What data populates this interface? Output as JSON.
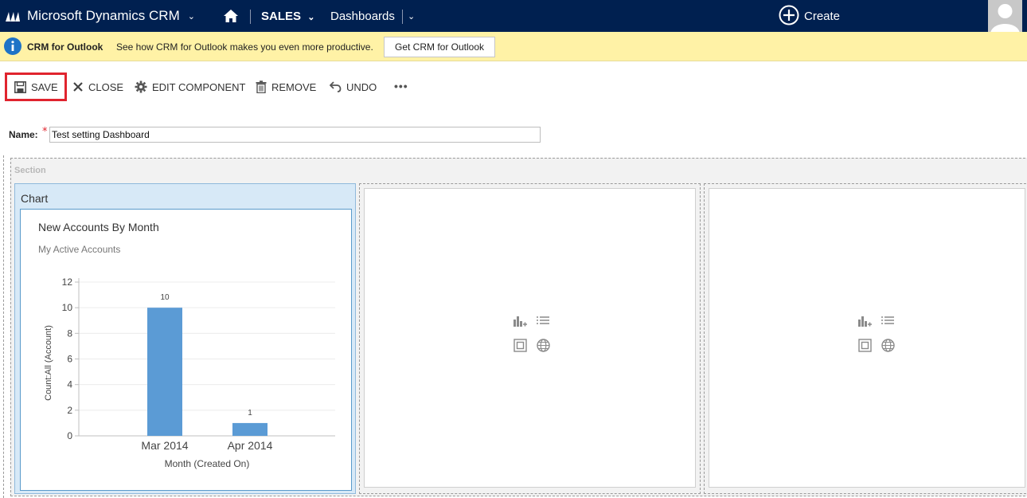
{
  "topnav": {
    "brand": "Microsoft Dynamics CRM",
    "area": "SALES",
    "section": "Dashboards",
    "create_label": "Create",
    "bg_color": "#002050"
  },
  "notification": {
    "title": "CRM for Outlook",
    "message": "See how CRM for Outlook makes you even more productive.",
    "button_label": "Get CRM for Outlook",
    "bg_color": "#fff2a6"
  },
  "commandbar": {
    "save": "SAVE",
    "close": "CLOSE",
    "edit_component": "EDIT COMPONENT",
    "remove": "REMOVE",
    "undo": "UNDO",
    "more": "•••"
  },
  "form": {
    "name_label": "Name:",
    "required_mark": "*",
    "name_value": "Test setting Dashboard"
  },
  "dashboard": {
    "section_label": "Section",
    "chart_component_label": "Chart",
    "empty_component_icons": [
      "chart-add-icon",
      "list-icon",
      "iframe-icon",
      "web-resource-icon"
    ]
  },
  "chart_data": {
    "type": "bar",
    "title": "New Accounts By Month",
    "subtitle": "My Active Accounts",
    "categories": [
      "Mar 2014",
      "Apr 2014"
    ],
    "values": [
      10,
      1
    ],
    "data_labels": [
      "10",
      "1"
    ],
    "xlabel": "Month (Created On)",
    "ylabel": "Count:All (Account)",
    "ylim": [
      0,
      12
    ],
    "yticks": [
      "0",
      "2",
      "4",
      "6",
      "8",
      "10",
      "12"
    ],
    "grid": true,
    "bar_color": "#5b9bd5"
  }
}
